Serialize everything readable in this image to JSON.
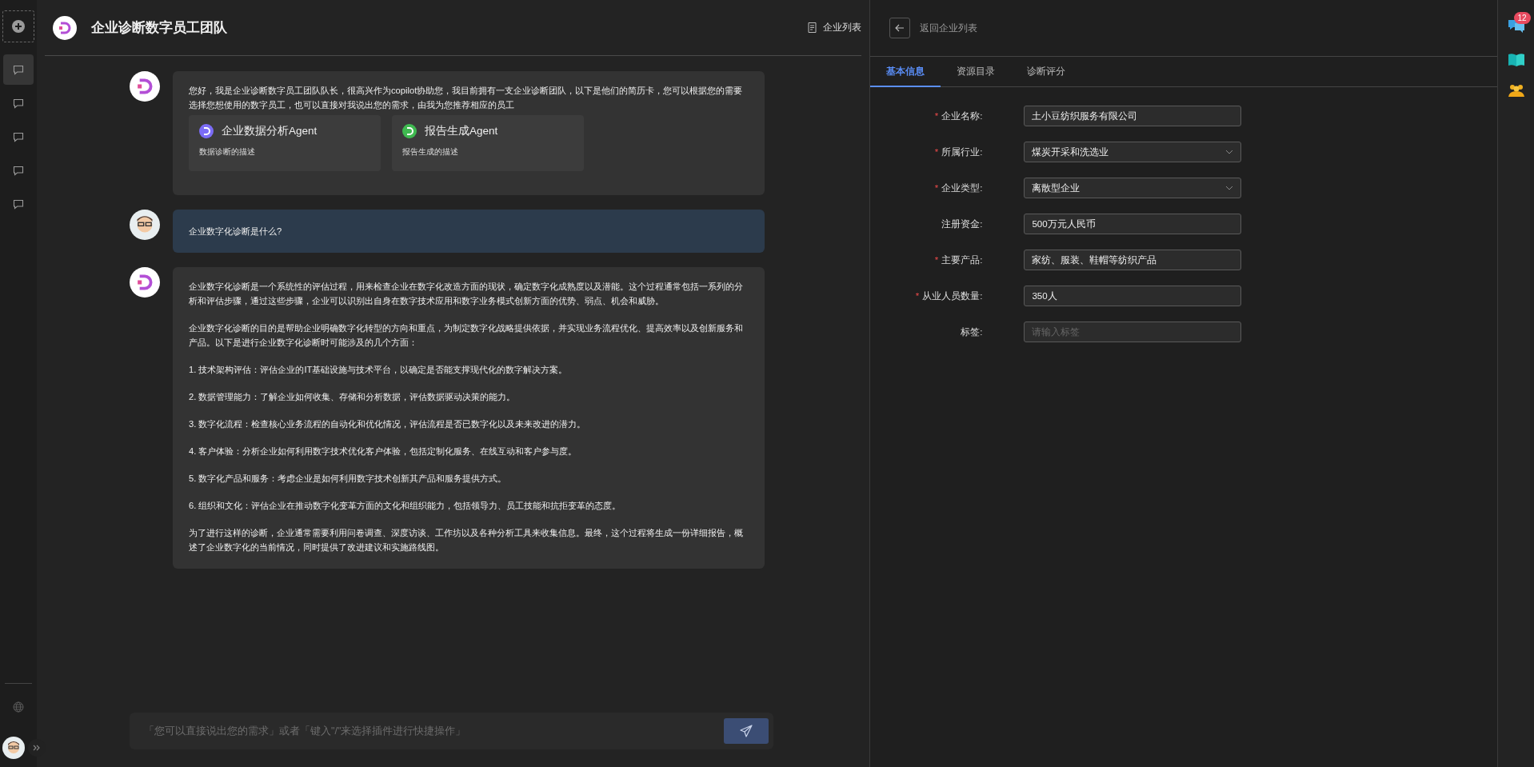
{
  "sidebar": {
    "items": [
      {
        "selected": true
      },
      {
        "selected": false
      },
      {
        "selected": false
      },
      {
        "selected": false
      },
      {
        "selected": false
      }
    ]
  },
  "header": {
    "title": "企业诊断数字员工团队",
    "list_link": "企业列表"
  },
  "messages": [
    {
      "kind": "bot",
      "paragraphs": [
        "您好，我是企业诊断数字员工团队队长，很高兴作为copilot协助您，我目前拥有一支企业诊断团队，以下是他们的简历卡，您可以根据您的需要选择您想使用的数字员工，也可以直接对我说出您的需求，由我为您推荐相应的员工"
      ],
      "agents": [
        {
          "name": "企业数据分析Agent",
          "description": "数据诊断的描述",
          "color": "#7b6cf6"
        },
        {
          "name": "报告生成Agent",
          "description": "报告生成的描述",
          "color": "#3fb950"
        }
      ]
    },
    {
      "kind": "user",
      "paragraphs": [
        "企业数字化诊断是什么?"
      ]
    },
    {
      "kind": "bot",
      "paragraphs": [
        "企业数字化诊断是一个系统性的评估过程，用来检查企业在数字化改造方面的现状，确定数字化成熟度以及潜能。这个过程通常包括一系列的分析和评估步骤，通过这些步骤，企业可以识别出自身在数字技术应用和数字业务模式创新方面的优势、弱点、机会和威胁。",
        "企业数字化诊断的目的是帮助企业明确数字化转型的方向和重点，为制定数字化战略提供依据，并实现业务流程优化、提高效率以及创新服务和产品。以下是进行企业数字化诊断时可能涉及的几个方面：",
        "1. 技术架构评估：评估企业的IT基础设施与技术平台，以确定是否能支撑现代化的数字解决方案。",
        "2. 数据管理能力：了解企业如何收集、存储和分析数据，评估数据驱动决策的能力。",
        "3. 数字化流程：检查核心业务流程的自动化和优化情况，评估流程是否已数字化以及未来改进的潜力。",
        "4. 客户体验：分析企业如何利用数字技术优化客户体验，包括定制化服务、在线互动和客户参与度。",
        "5. 数字化产品和服务：考虑企业是如何利用数字技术创新其产品和服务提供方式。",
        "6. 组织和文化：评估企业在推动数字化变革方面的文化和组织能力，包括领导力、员工技能和抗拒变革的态度。",
        "为了进行这样的诊断，企业通常需要利用问卷调查、深度访谈、工作坊以及各种分析工具来收集信息。最终，这个过程将生成一份详细报告，概述了企业数字化的当前情况，同时提供了改进建议和实施路线图。"
      ]
    }
  ],
  "composer": {
    "placeholder": "「您可以直接说出您的需求」或者「键入\"/\"来选择插件进行快捷操作」"
  },
  "panel": {
    "back_label": "返回企业列表",
    "required_mark": "*",
    "tabs": [
      {
        "label": "基本信息",
        "selected": true
      },
      {
        "label": "资源目录",
        "selected": false
      },
      {
        "label": "诊断评分",
        "selected": false
      }
    ],
    "fields": [
      {
        "label": "企业名称:",
        "required": true,
        "kind": "input",
        "value": "土小豆纺织服务有限公司"
      },
      {
        "label": "所属行业:",
        "required": true,
        "kind": "select",
        "value": "煤炭开采和洗选业"
      },
      {
        "label": "企业类型:",
        "required": true,
        "kind": "select",
        "value": "离散型企业"
      },
      {
        "label": "注册资金:",
        "required": false,
        "kind": "input",
        "value": "500万元人民币"
      },
      {
        "label": "主要产品:",
        "required": true,
        "kind": "input",
        "value": "家纺、服装、鞋帽等纺织产品"
      },
      {
        "label": "从业人员数量:",
        "required": true,
        "kind": "input",
        "value": "350人"
      },
      {
        "label": "标签:",
        "required": false,
        "kind": "input",
        "placeholder": "请输入标签"
      }
    ]
  },
  "rightbar": {
    "badge": "12"
  }
}
